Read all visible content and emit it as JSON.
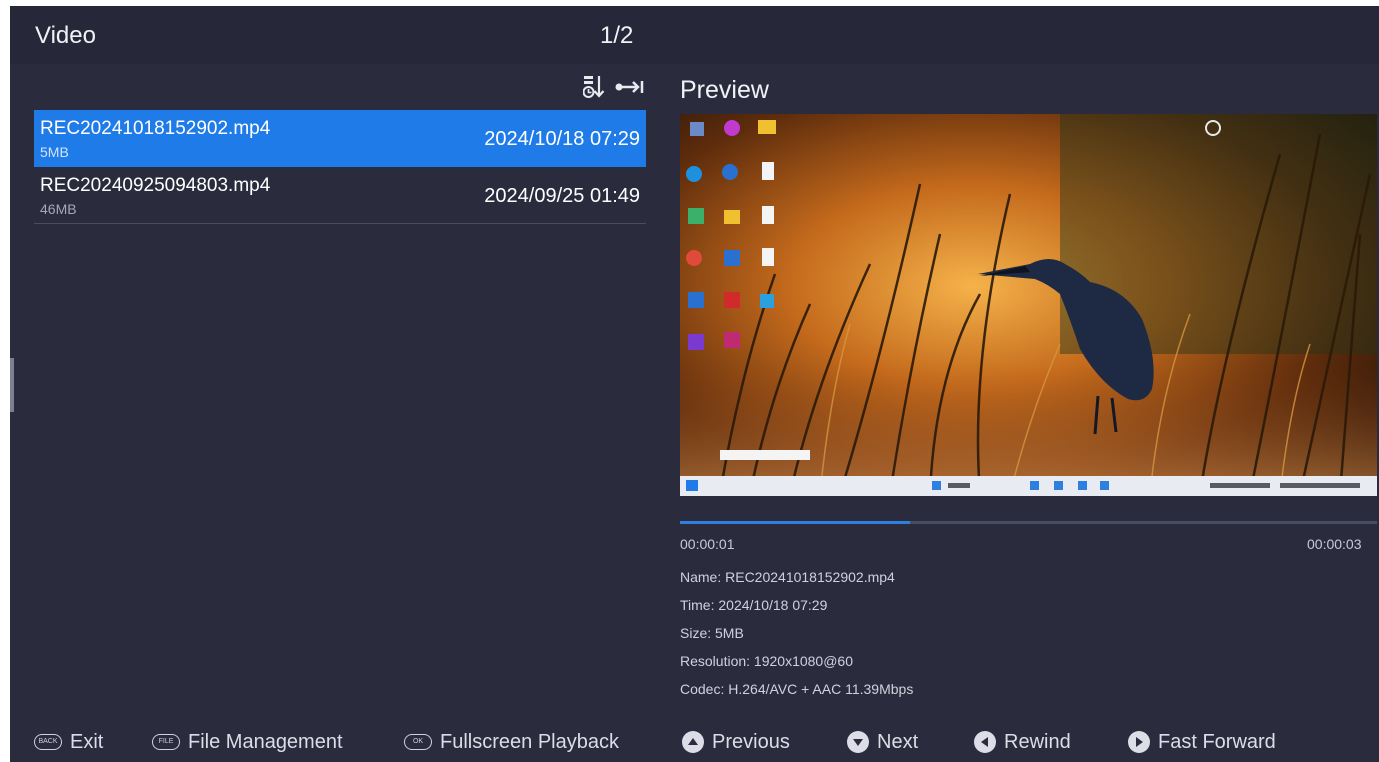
{
  "header": {
    "title": "Video",
    "page_indicator": "1/2"
  },
  "toolbar": {
    "sort_icon": "sort-descending-icon",
    "expand_icon": "expand-arrow-icon"
  },
  "files": [
    {
      "name": "REC20241018152902.mp4",
      "size": "5MB",
      "date": "2024/10/18 07:29",
      "selected": true
    },
    {
      "name": "REC20240925094803.mp4",
      "size": "46MB",
      "date": "2024/09/25 01:49",
      "selected": false
    }
  ],
  "preview": {
    "title": "Preview",
    "progress": {
      "current": "00:00:01",
      "total": "00:00:03",
      "fraction": 0.33
    },
    "info": {
      "name": "Name: REC20241018152902.mp4",
      "time": "Time: 2024/10/18 07:29",
      "size": "Size: 5MB",
      "resolution": "Resolution: 1920x1080@60",
      "codec": "Codec: H.264/AVC + AAC 11.39Mbps"
    }
  },
  "footer": {
    "exit": {
      "key": "BACK",
      "label": "Exit"
    },
    "file_management": {
      "key": "FILE",
      "label": "File Management"
    },
    "fullscreen": {
      "key": "OK",
      "label": "Fullscreen Playback"
    },
    "previous": {
      "label": "Previous",
      "icon": "up-arrow-icon"
    },
    "next": {
      "label": "Next",
      "icon": "down-arrow-icon"
    },
    "rewind": {
      "label": "Rewind",
      "icon": "left-arrow-icon"
    },
    "fast_forward": {
      "label": "Fast Forward",
      "icon": "right-arrow-icon"
    }
  },
  "colors": {
    "background": "#2a2c3e",
    "header": "#262839",
    "selection": "#1f7be8",
    "progress": "#2e7fe0"
  }
}
